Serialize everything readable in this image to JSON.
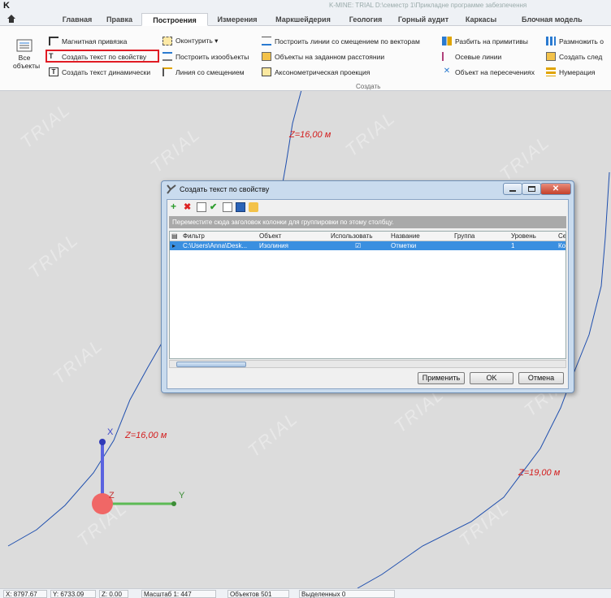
{
  "app": {
    "logo": "K",
    "title": "K-MINE: TRIAL D:\\семестр 1\\Прикладне программе забезпечення"
  },
  "tabs": [
    "Главная",
    "Правка",
    "Построения",
    "Измерения",
    "Маркшейдерия",
    "Геология",
    "Горный аудит",
    "Каркасы",
    "Блочная модель"
  ],
  "ribbon": {
    "all_objects": "Все объекты",
    "col1": [
      "Магнитная привязка",
      "Создать текст по свойству",
      "Создать текст динамически"
    ],
    "col2": [
      "Оконтурить ▾",
      "Построить изообъекты",
      "Линия со смещением"
    ],
    "col3": [
      "Построить линии со смещением по векторам",
      "Объекты на заданном расстоянии",
      "Аксонометрическая проекция"
    ],
    "col4": [
      "Разбить на примитивы",
      "Осевые линии",
      "Объект на пересечениях"
    ],
    "col5": [
      "Размножить о",
      "Создать след",
      "Нумерация"
    ],
    "group_label": "Создать"
  },
  "canvas": {
    "watermark": "TRIAL",
    "labels": [
      "Z=16,00 м",
      "Z=16,00 м",
      "Z=19,00 м"
    ],
    "axis_x": "X",
    "axis_y": "Y",
    "axis_z": "Z"
  },
  "dialog": {
    "title": "Создать текст по свойству",
    "group_hint": "Переместите сюда заголовок колонки для группировки по этому столбцу.",
    "columns": [
      "Фильтр",
      "Объект",
      "Использовать",
      "Название",
      "Группа",
      "Уровень",
      "Cе"
    ],
    "row": {
      "filter": "C:\\Users\\Anna\\Desk...",
      "object": "Изолиния",
      "use": "☑",
      "name": "Отметки",
      "group": "",
      "level": "1",
      "extra": "Ко"
    },
    "buttons": {
      "apply": "Применить",
      "ok": "OK",
      "cancel": "Отмена"
    }
  },
  "status": {
    "x": "X: 8797.67",
    "y": "Y: 6733.09",
    "z": "Z: 0.00",
    "scale": "Масштаб 1: 447",
    "objects": "Объектов 501",
    "selected": "Выделенных 0"
  },
  "colors": {
    "highlight": "#e01b24",
    "contour": "#1f4fae",
    "label": "#d31c1c",
    "selection": "#3a8fe0"
  }
}
